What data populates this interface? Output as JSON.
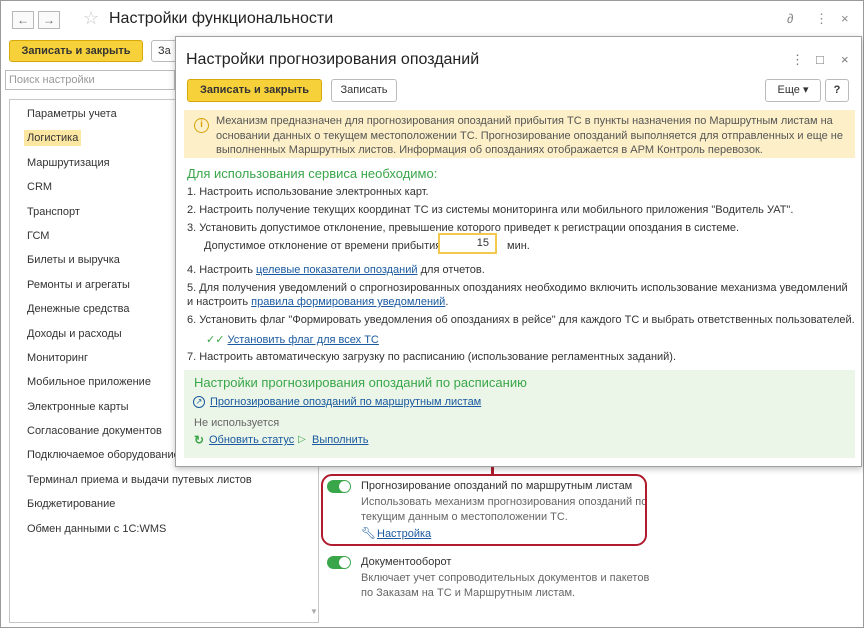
{
  "bg_window": {
    "title": "Настройки функциональности",
    "back_icon": "←",
    "forward_icon": "→",
    "save_close_label": "Записать и закрыть",
    "save_label_partial": "За",
    "search_placeholder": "Поиск настройки",
    "sidebar_items": [
      "Параметры учета",
      "Логистика",
      "Маршрутизация",
      "CRM",
      "Транспорт",
      "ГСМ",
      "Билеты и выручка",
      "Ремонты и агрегаты",
      "Денежные средства",
      "Доходы и расходы",
      "Мониторинг",
      "Мобильное приложение",
      "Электронные карты",
      "Согласование документов",
      "Подключаемое оборудование",
      "Терминал приема и выдачи путевых листов",
      "Бюджетирование",
      "Обмен данными с 1С:WMS"
    ],
    "selected_item": "Логистика"
  },
  "options": {
    "forecast": {
      "title": "Прогнозирование опозданий по маршрутным листам",
      "desc_line1": "Использовать механизм прогнозирования опозданий по",
      "desc_line2": "текущим данным о местоположении ТС.",
      "settings_link": "Настройка"
    },
    "docflow": {
      "title": "Документооборот",
      "desc_line1": "Включает учет сопроводительных документов и пакетов",
      "desc_line2": "по Заказам на ТС и Маршрутным листам."
    }
  },
  "dialog": {
    "title": "Настройки прогнозирования опозданий",
    "save_close_label": "Записать и закрыть",
    "save_label": "Записать",
    "more_label": "Еще ▾",
    "help_label": "?",
    "info_text": "Механизм предназначен для прогнозирования опозданий прибытия ТС в пункты назначения по Маршрутным листам на основании данных о текущем местоположении ТС. Прогнозирование опозданий выполняется для отправленных и еще не выполненных Маршрутных листов. Информация об опозданиях отображается в АРМ Контроль перевозок.",
    "requirements_heading": "Для использования сервиса необходимо:",
    "step1": "1. Настроить использование электронных карт.",
    "step2": "2. Настроить получение текущих координат ТС из системы мониторинга или мобильного приложения \"Водитель УАТ\".",
    "step3": "3. Установить допустимое отклонение, превышение которого приведет к регистрации опоздания в системе.",
    "deviation_label": "Допустимое отклонение от времени прибытия:",
    "deviation_value": "15",
    "deviation_unit": "мин.",
    "step4_prefix": "4. Настроить ",
    "step4_link": "целевые показатели опозданий",
    "step4_suffix": " для отчетов.",
    "step5_line1": "5. Для получения уведомлений о спрогнозированных опозданиях необходимо включить использование механизма уведомлений",
    "step5_prefix": "и настроить ",
    "step5_link": "правила формирования уведомлений",
    "step5_suffix": ".",
    "step6": "6. Установить флаг \"Формировать уведомления об опозданиях в рейсе\" для каждого ТС и выбрать ответственных пользователей.",
    "step6_link": "Установить флаг для всех ТС",
    "step7": "7. Настроить автоматическую загрузку по расписанию (использование регламентных заданий).",
    "schedule": {
      "heading": "Настройки прогнозирования опозданий по расписанию",
      "job_link": "Прогнозирование опозданий по маршрутным листам",
      "status": "Не используется",
      "refresh_label": "Обновить статус",
      "run_label": "Выполнить"
    }
  },
  "colors": {
    "accent_yellow": "#f7d13a",
    "green": "#3aa64a",
    "link": "#1a5aa0",
    "highlight_red": "#b01b2e"
  }
}
